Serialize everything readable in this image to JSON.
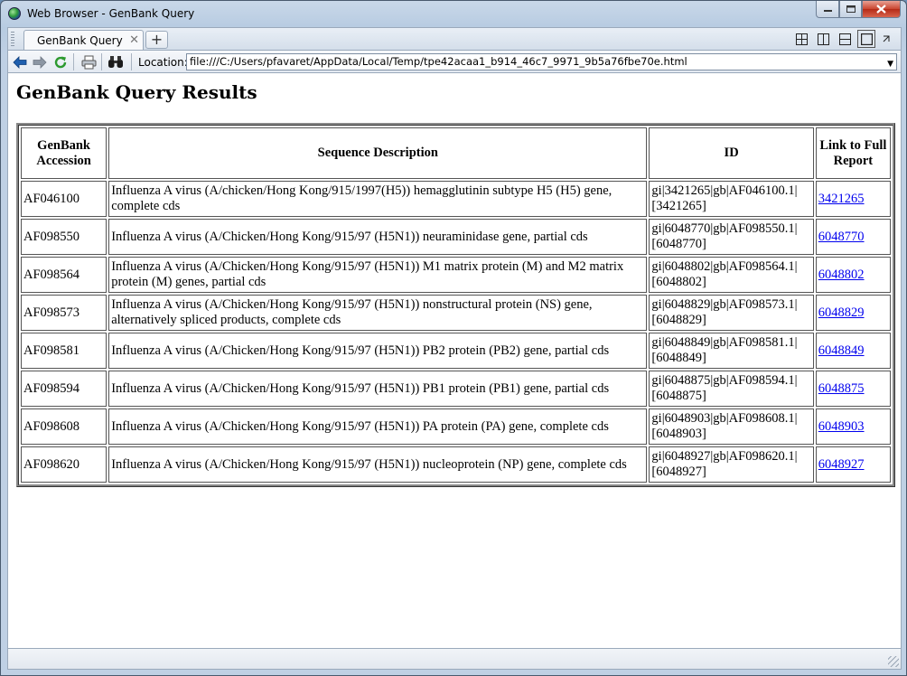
{
  "window": {
    "title": "Web Browser - GenBank Query",
    "controls": [
      "minimize-icon",
      "maximize-icon",
      "close-icon"
    ]
  },
  "tabs": [
    {
      "label": "GenBank Query",
      "close": "✕",
      "active": true
    }
  ],
  "tab_add_label": "+",
  "toolbar": {
    "location_label": "Location:",
    "location_url": "file:///C:/Users/pfavaret/AppData/Local/Temp/tpe42acaa1_b914_46c7_9971_9b5a76fbe70e.html",
    "icons": [
      "back-arrow-icon",
      "forward-arrow-icon",
      "refresh-icon",
      "print-icon",
      "find-binoculars-icon"
    ]
  },
  "page": {
    "heading": "GenBank Query Results",
    "table": {
      "headers": {
        "accession": "GenBank Accession",
        "description": "Sequence Description",
        "id": "ID",
        "link": "Link to Full Report"
      },
      "rows": [
        {
          "accession": "AF046100",
          "description": "Influenza A virus (A/chicken/Hong Kong/915/1997(H5)) hemagglutinin subtype H5 (H5) gene, complete cds",
          "id": "gi|3421265|gb|AF046100.1|[3421265]",
          "link": "3421265"
        },
        {
          "accession": "AF098550",
          "description": "Influenza A virus (A/Chicken/Hong Kong/915/97 (H5N1)) neuraminidase gene, partial cds",
          "id": "gi|6048770|gb|AF098550.1|[6048770]",
          "link": "6048770"
        },
        {
          "accession": "AF098564",
          "description": "Influenza A virus (A/Chicken/Hong Kong/915/97 (H5N1)) M1 matrix protein (M) and M2 matrix protein (M) genes, partial cds",
          "id": "gi|6048802|gb|AF098564.1|[6048802]",
          "link": "6048802"
        },
        {
          "accession": "AF098573",
          "description": "Influenza A virus (A/Chicken/Hong Kong/915/97 (H5N1)) nonstructural protein (NS) gene, alternatively spliced products, complete cds",
          "id": "gi|6048829|gb|AF098573.1|[6048829]",
          "link": "6048829"
        },
        {
          "accession": "AF098581",
          "description": "Influenza A virus (A/Chicken/Hong Kong/915/97 (H5N1)) PB2 protein (PB2) gene, partial cds",
          "id": "gi|6048849|gb|AF098581.1|[6048849]",
          "link": "6048849"
        },
        {
          "accession": "AF098594",
          "description": "Influenza A virus (A/Chicken/Hong Kong/915/97 (H5N1)) PB1 protein (PB1) gene, partial cds",
          "id": "gi|6048875|gb|AF098594.1|[6048875]",
          "link": "6048875"
        },
        {
          "accession": "AF098608",
          "description": "Influenza A virus (A/Chicken/Hong Kong/915/97 (H5N1)) PA protein (PA) gene, complete cds",
          "id": "gi|6048903|gb|AF098608.1|[6048903]",
          "link": "6048903"
        },
        {
          "accession": "AF098620",
          "description": "Influenza A virus (A/Chicken/Hong Kong/915/97 (H5N1)) nucleoprotein (NP) gene, complete cds",
          "id": "gi|6048927|gb|AF098620.1|[6048927]",
          "link": "6048927"
        }
      ]
    }
  },
  "colors": {
    "link": "#0000ee",
    "close_button": "#c9452f"
  }
}
